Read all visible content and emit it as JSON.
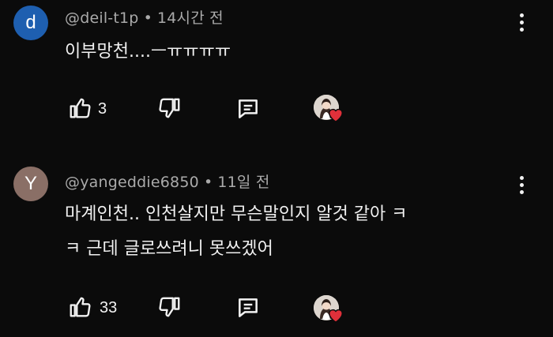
{
  "comments": [
    {
      "avatar_letter": "d",
      "avatar_color": "#1e5fb0",
      "username": "@deil-t1p",
      "separator": "•",
      "time": "14시간 전",
      "lines": [
        "이부망천....ㅡㅠㅠㅠㅠ"
      ],
      "likes": "3",
      "menu_icon": "more-vert-icon",
      "like_icon": "thumbs-up-icon",
      "dislike_icon": "thumbs-down-icon",
      "reply_icon": "reply-comment-icon",
      "creator_heart": "creator-heart-icon"
    },
    {
      "avatar_letter": "Y",
      "avatar_color": "#8a6f66",
      "username": "@yangeddie6850",
      "separator": "•",
      "time": "11일 전",
      "lines": [
        "마계인천.. 인천살지만 무슨말인지 알것 같아 ㅋ",
        "ㅋ 근데 글로쓰려니 못쓰겠어"
      ],
      "likes": "33",
      "menu_icon": "more-vert-icon",
      "like_icon": "thumbs-up-icon",
      "dislike_icon": "thumbs-down-icon",
      "reply_icon": "reply-comment-icon",
      "creator_heart": "creator-heart-icon"
    }
  ],
  "colors": {
    "background": "#0b0b0b",
    "text": "#f1f1f1",
    "meta": "#aaaaaa",
    "heart": "#e0303a"
  }
}
